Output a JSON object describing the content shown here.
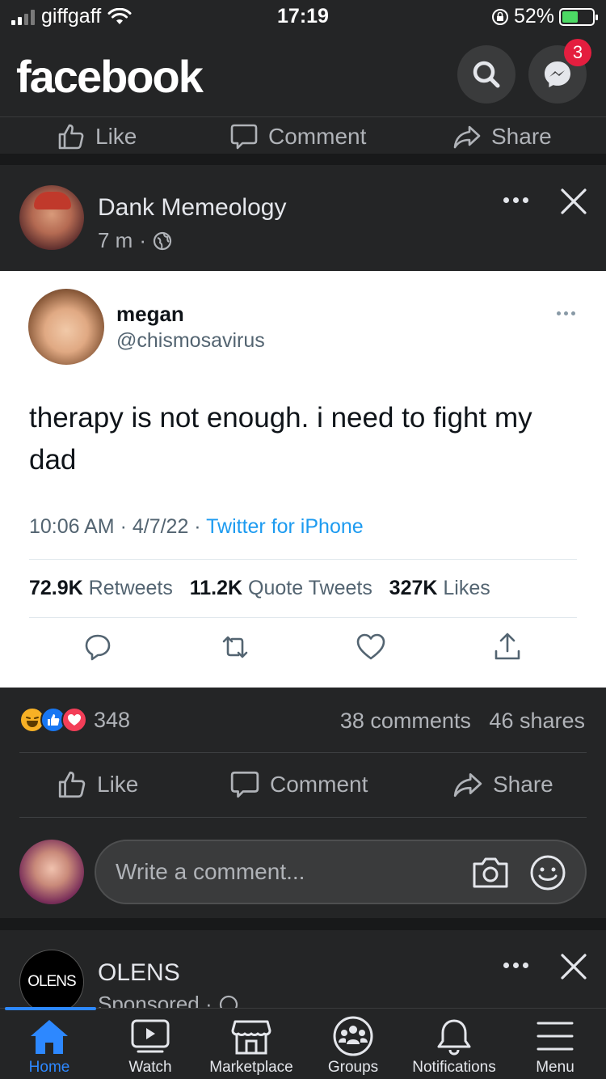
{
  "status_bar": {
    "carrier": "giffgaff",
    "time": "17:19",
    "battery": "52%",
    "battery_level": 0.52
  },
  "header": {
    "logo": "facebook",
    "messenger_badge": "3"
  },
  "previous_post_actions": {
    "like": "Like",
    "comment": "Comment",
    "share": "Share"
  },
  "post": {
    "author": "Dank Memeology",
    "time": "7 m",
    "tweet": {
      "name": "megan",
      "handle": "@chismosavirus",
      "text": "therapy is not enough. i need to fight my dad",
      "timestamp": "10:06 AM · 4/7/22 · ",
      "source": "Twitter for iPhone",
      "retweets_value": "72.9K",
      "retweets_label": " Retweets",
      "quotes_value": "11.2K",
      "quotes_label": " Quote Tweets",
      "likes_value": "327K",
      "likes_label": " Likes"
    },
    "reactions_count": "348",
    "comments": "38 comments",
    "shares": "46 shares",
    "actions": {
      "like": "Like",
      "comment": "Comment",
      "share": "Share"
    },
    "comment_placeholder": "Write a comment..."
  },
  "next_post": {
    "author": "OLENS",
    "meta": "Sponsored ·",
    "logo_text": "OLENS"
  },
  "tabs": [
    {
      "label": "Home",
      "icon": "home-icon",
      "active": true
    },
    {
      "label": "Watch",
      "icon": "watch-icon"
    },
    {
      "label": "Marketplace",
      "icon": "marketplace-icon"
    },
    {
      "label": "Groups",
      "icon": "groups-icon"
    },
    {
      "label": "Notifications",
      "icon": "bell-icon"
    },
    {
      "label": "Menu",
      "icon": "menu-icon"
    }
  ],
  "colors": {
    "background": "#242526",
    "accent": "#2d88ff",
    "badge": "#e41e3f",
    "twitter_link": "#1d9bf0"
  }
}
